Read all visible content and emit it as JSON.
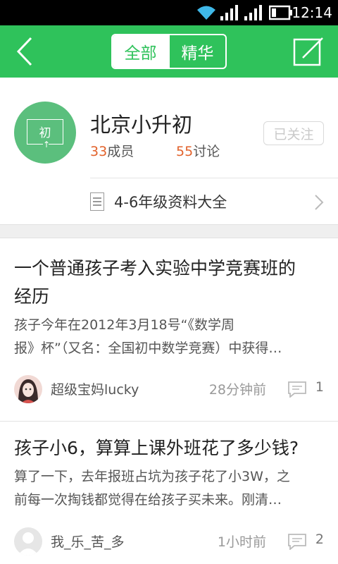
{
  "status_bar": {
    "time": "12:14",
    "icons": [
      "wifi-icon",
      "signal-icon",
      "signal-icon",
      "battery-icon"
    ]
  },
  "header": {
    "back_icon": "chevron-left-icon",
    "tabs": [
      {
        "label": "全部",
        "active": true
      },
      {
        "label": "精华",
        "active": false
      }
    ],
    "edit_icon": "compose-icon",
    "accent_color": "#2fc25b"
  },
  "group": {
    "avatar_glyph": "初",
    "name": "北京小升初",
    "members_count": "33",
    "members_label": "成员",
    "discussions_count": "55",
    "discussions_label": "讨论",
    "follow_label": "已关注",
    "resource_label": "4-6年级资料大全"
  },
  "posts": [
    {
      "title_line1": "一个普通孩子考入实验中学竞赛班的",
      "title_line2": "经历",
      "excerpt_line1": "孩子今年在2012年3月18号“《数学周",
      "excerpt_line2": "报》杯”（又名：全国初中数学竞赛）中获得…",
      "author": "超级宝妈lucky",
      "time": "28分钟前",
      "comments": "1"
    },
    {
      "title_line1": "孩子小6，算算上课外班花了多少钱?",
      "excerpt_line1": "算了一下，去年报班占坑为孩子花了小3W，之",
      "excerpt_line2": "前每一次掏钱都觉得在给孩子买未来。刚清…",
      "author": "我_乐_苦_多",
      "time": "1小时前",
      "comments": "2"
    }
  ]
}
